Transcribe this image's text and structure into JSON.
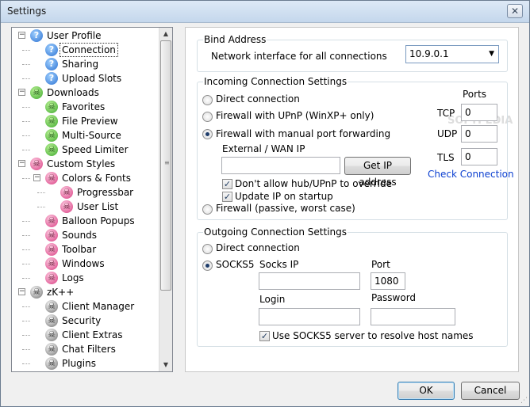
{
  "window": {
    "title": "Settings",
    "close_glyph": "✕"
  },
  "tree": {
    "items": [
      {
        "label": "User Profile",
        "icon": "blue-globe-icon",
        "level": 0,
        "expander": "−"
      },
      {
        "label": "Connection",
        "icon": "blue-globe-icon",
        "level": 1,
        "selected": true
      },
      {
        "label": "Sharing",
        "icon": "blue-globe-icon",
        "level": 1
      },
      {
        "label": "Upload Slots",
        "icon": "blue-globe-icon",
        "level": 1
      },
      {
        "label": "Downloads",
        "icon": "green-skull-icon",
        "level": 0,
        "expander": "−"
      },
      {
        "label": "Favorites",
        "icon": "green-skull-icon",
        "level": 1
      },
      {
        "label": "File Preview",
        "icon": "green-skull-icon",
        "level": 1
      },
      {
        "label": "Multi-Source",
        "icon": "green-skull-icon",
        "level": 1
      },
      {
        "label": "Speed Limiter",
        "icon": "green-skull-icon",
        "level": 1
      },
      {
        "label": "Custom Styles",
        "icon": "pink-skull-icon",
        "level": 0,
        "expander": "−"
      },
      {
        "label": "Colors & Fonts",
        "icon": "pink-skull-icon",
        "level": 1,
        "expander": "−"
      },
      {
        "label": "Progressbar",
        "icon": "pink-skull-icon",
        "level": 2
      },
      {
        "label": "User List",
        "icon": "pink-skull-icon",
        "level": 2
      },
      {
        "label": "Balloon Popups",
        "icon": "pink-skull-icon",
        "level": 1
      },
      {
        "label": "Sounds",
        "icon": "pink-skull-icon",
        "level": 1
      },
      {
        "label": "Toolbar",
        "icon": "pink-skull-icon",
        "level": 1
      },
      {
        "label": "Windows",
        "icon": "pink-skull-icon",
        "level": 1
      },
      {
        "label": "Logs",
        "icon": "pink-skull-icon",
        "level": 1
      },
      {
        "label": "zK++",
        "icon": "bw-skull-icon",
        "level": 0,
        "expander": "−"
      },
      {
        "label": "Client Manager",
        "icon": "bw-skull-icon",
        "level": 1
      },
      {
        "label": "Security",
        "icon": "bw-skull-icon",
        "level": 1
      },
      {
        "label": "Client Extras",
        "icon": "bw-skull-icon",
        "level": 1
      },
      {
        "label": "Chat Filters",
        "icon": "bw-skull-icon",
        "level": 1
      },
      {
        "label": "Plugins",
        "icon": "bw-skull-icon",
        "level": 1
      }
    ]
  },
  "bind": {
    "legend": "Bind Address",
    "label": "Network interface for all connections",
    "value": "10.9.0.1"
  },
  "incoming": {
    "legend": "Incoming Connection Settings",
    "direct": "Direct connection",
    "upnp": "Firewall with UPnP (WinXP+ only)",
    "manual": "Firewall with manual port forwarding",
    "wan_label": "External / WAN IP",
    "wan_value": "",
    "get_ip": "Get IP address",
    "no_override": "Don't allow hub/UPnP to override",
    "update_ip": "Update IP on startup",
    "passive": "Firewall (passive, worst case)",
    "ports_label": "Ports",
    "tcp_label": "TCP",
    "tcp_value": "0",
    "udp_label": "UDP",
    "udp_value": "0",
    "tls_label": "TLS",
    "tls_value": "0",
    "check_connection": "Check Connection"
  },
  "outgoing": {
    "legend": "Outgoing Connection Settings",
    "direct": "Direct connection",
    "socks5": "SOCKS5",
    "socks_ip_label": "Socks IP",
    "socks_ip_value": "",
    "port_label": "Port",
    "port_value": "1080",
    "login_label": "Login",
    "login_value": "",
    "password_label": "Password",
    "password_value": "",
    "resolve": "Use SOCKS5 server to resolve host names"
  },
  "buttons": {
    "ok": "OK",
    "cancel": "Cancel"
  },
  "watermark": "SOFTPEDIA"
}
